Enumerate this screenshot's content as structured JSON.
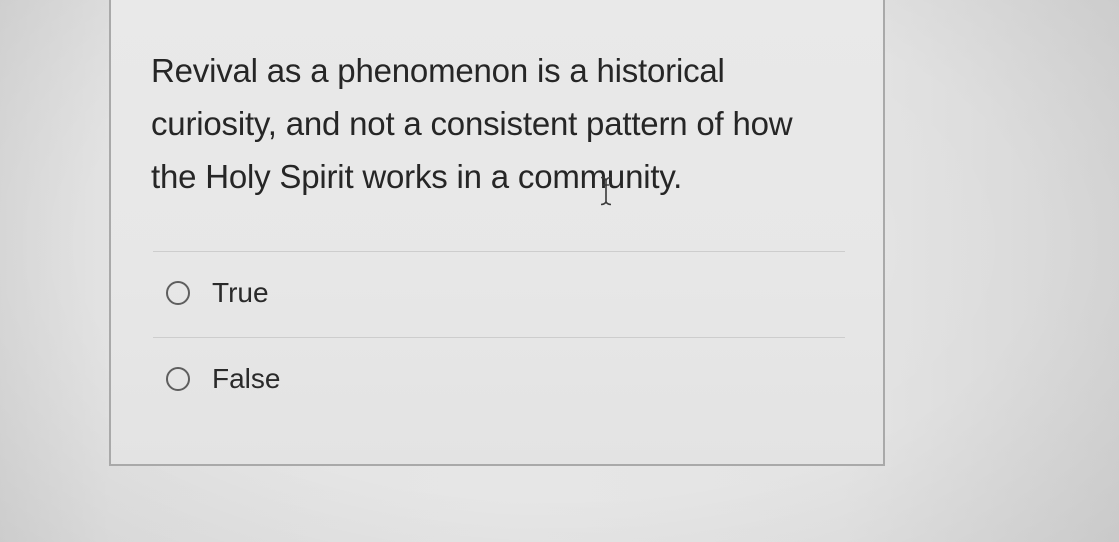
{
  "question": {
    "text": "Revival as a phenomenon is a historical curiosity, and not a consistent pattern of how the Holy Spirit works in a community."
  },
  "options": [
    {
      "label": "True",
      "selected": false
    },
    {
      "label": "False",
      "selected": false
    }
  ],
  "cursor": {
    "icon": "text-ibeam-cursor-icon"
  }
}
